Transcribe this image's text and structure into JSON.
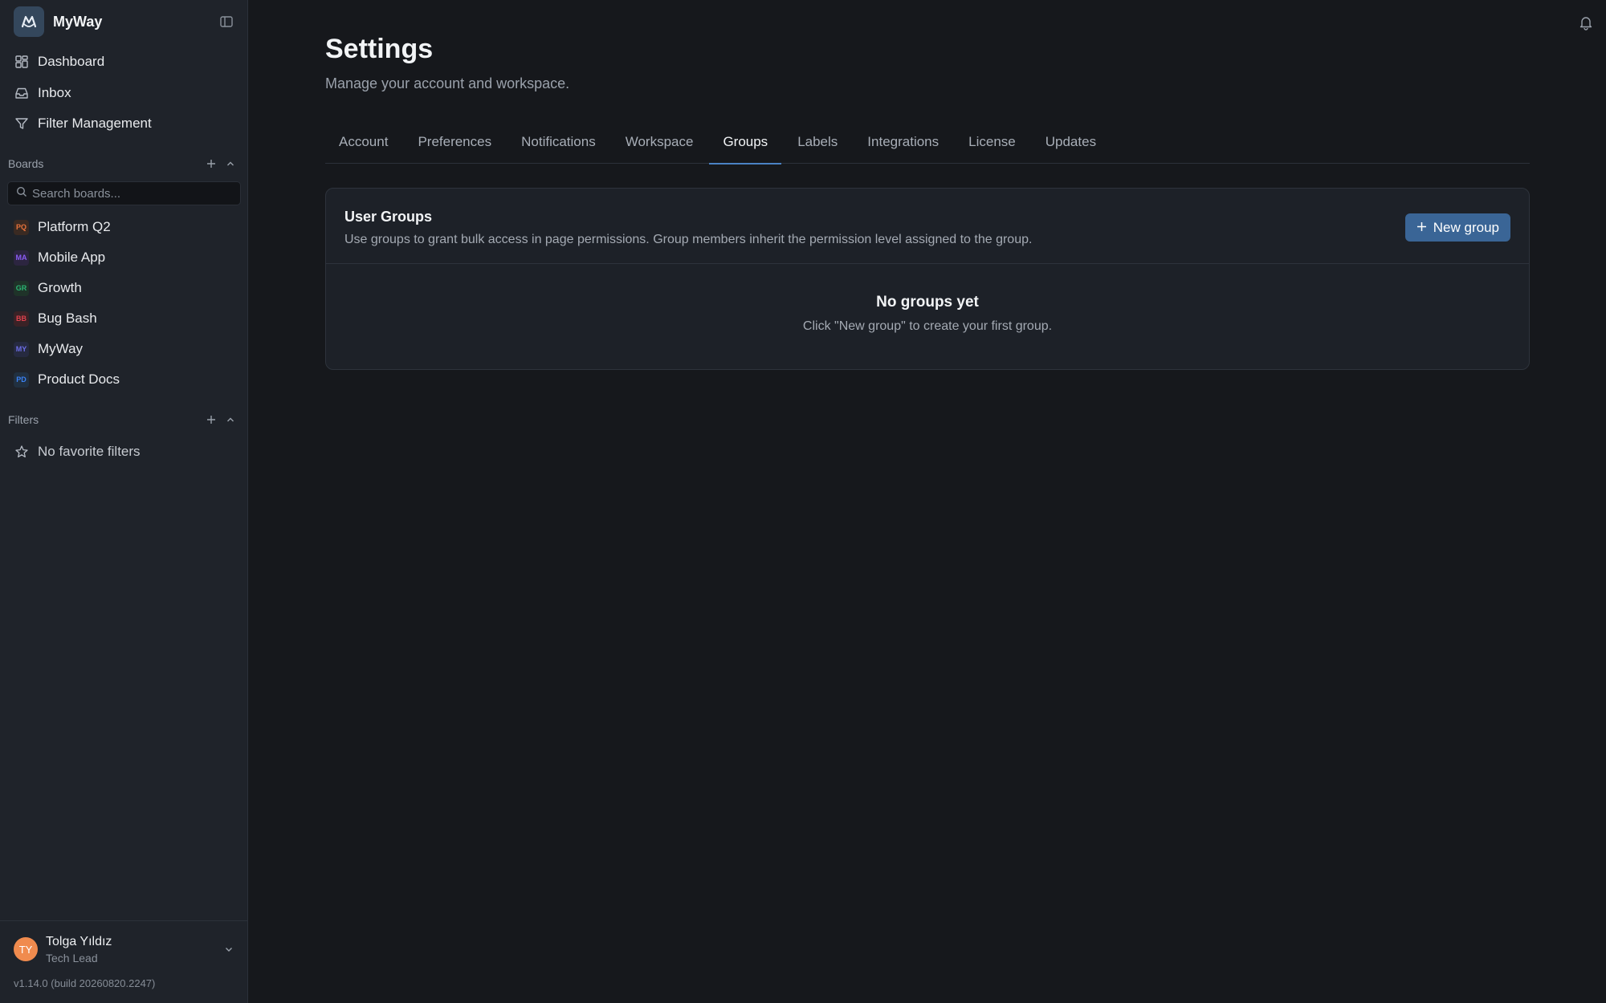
{
  "app": {
    "name": "MyWay"
  },
  "nav": {
    "dashboard": "Dashboard",
    "inbox": "Inbox",
    "filter_management": "Filter Management"
  },
  "boards": {
    "heading": "Boards",
    "search_placeholder": "Search boards...",
    "items": [
      {
        "abbr": "PQ",
        "label": "Platform Q2",
        "color": "#e8733c",
        "bg": "#3a2a22"
      },
      {
        "abbr": "MA",
        "label": "Mobile App",
        "color": "#8b5cf6",
        "bg": "#2c2540"
      },
      {
        "abbr": "GR",
        "label": "Growth",
        "color": "#2bb673",
        "bg": "#1f3329"
      },
      {
        "abbr": "BB",
        "label": "Bug Bash",
        "color": "#e0414d",
        "bg": "#3a2226"
      },
      {
        "abbr": "MY",
        "label": "MyWay",
        "color": "#6d6ee8",
        "bg": "#262a40"
      },
      {
        "abbr": "PD",
        "label": "Product Docs",
        "color": "#3b82f6",
        "bg": "#213040"
      }
    ]
  },
  "filters": {
    "heading": "Filters",
    "empty": "No favorite filters"
  },
  "user": {
    "initials": "TY",
    "name": "Tolga Yıldız",
    "role": "Tech Lead",
    "version": "v1.14.0 (build 20260820.2247)"
  },
  "page": {
    "title": "Settings",
    "subtitle": "Manage your account and workspace."
  },
  "tabs": [
    {
      "label": "Account",
      "active": false
    },
    {
      "label": "Preferences",
      "active": false
    },
    {
      "label": "Notifications",
      "active": false
    },
    {
      "label": "Workspace",
      "active": false
    },
    {
      "label": "Groups",
      "active": true
    },
    {
      "label": "Labels",
      "active": false
    },
    {
      "label": "Integrations",
      "active": false
    },
    {
      "label": "License",
      "active": false
    },
    {
      "label": "Updates",
      "active": false
    }
  ],
  "groups": {
    "title": "User Groups",
    "description": "Use groups to grant bulk access in page permissions. Group members inherit the permission level assigned to the group.",
    "new_button": "New group",
    "empty_title": "No groups yet",
    "empty_sub": "Click \"New group\" to create your first group."
  },
  "colors": {
    "accent": "#4a82c4",
    "primary_button": "#3a6596"
  }
}
